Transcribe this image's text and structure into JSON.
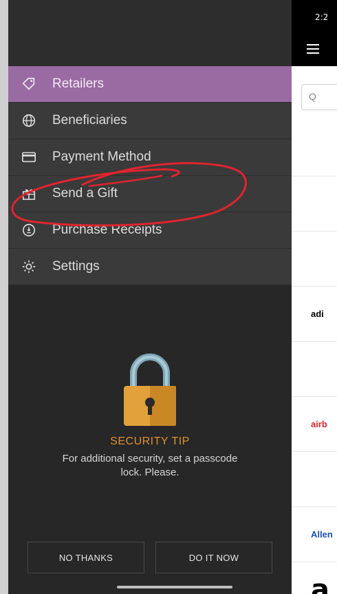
{
  "menu": {
    "items": [
      {
        "label": "Retailers",
        "icon": "tag-icon",
        "active": true
      },
      {
        "label": "Beneficiaries",
        "icon": "globe-icon",
        "active": false
      },
      {
        "label": "Payment Method",
        "icon": "credit-card-icon",
        "active": false
      },
      {
        "label": "Send a Gift",
        "icon": "gift-icon",
        "active": false
      },
      {
        "label": "Purchase Receipts",
        "icon": "receipt-icon",
        "active": false
      },
      {
        "label": "Settings",
        "icon": "gear-icon",
        "active": false
      }
    ]
  },
  "security_tip": {
    "title": "SECURITY TIP",
    "text": "For additional security, set a passcode lock. Please.",
    "lock_icon": "padlock-icon"
  },
  "buttons": {
    "no_thanks": "NO THANKS",
    "do_it_now": "DO IT NOW"
  },
  "background_app": {
    "status_time": "2:2",
    "search_placeholder": "Q",
    "logos": [
      "",
      "",
      "",
      "adi",
      "",
      "airb",
      "",
      "Allen",
      "a"
    ]
  },
  "colors": {
    "active_item": "#9a6aa3",
    "tip_title": "#e2902b",
    "annotation_circle": "#e0242e"
  }
}
